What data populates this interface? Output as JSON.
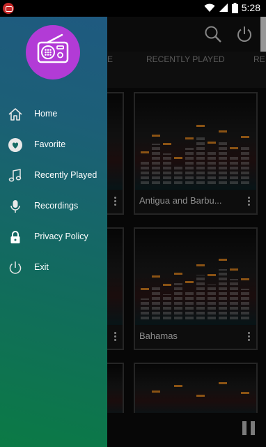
{
  "status_bar": {
    "time": "5:28",
    "icons": [
      "notification-icon",
      "wifi-icon",
      "signal-icon",
      "battery-icon"
    ]
  },
  "app_bar": {
    "icons": [
      "search-icon",
      "power-icon"
    ]
  },
  "tabs": [
    {
      "label": "E"
    },
    {
      "label": "RECENTLY PLAYED"
    },
    {
      "label": "RE"
    }
  ],
  "stations": [
    {
      "title": "Antigua and Barbu..."
    },
    {
      "title": "Bahamas"
    }
  ],
  "drawer": {
    "logo_icon": "radio-icon",
    "items": [
      {
        "label": "Home",
        "icon": "home-icon"
      },
      {
        "label": "Favorite",
        "icon": "heart-icon"
      },
      {
        "label": "Recently Played",
        "icon": "music-note-icon"
      },
      {
        "label": "Recordings",
        "icon": "microphone-icon"
      },
      {
        "label": "Privacy Policy",
        "icon": "lock-icon"
      },
      {
        "label": "Exit",
        "icon": "power-icon"
      }
    ]
  },
  "player": {
    "control_icon": "pause-icon"
  },
  "colors": {
    "drawer_top": "#1f5a80",
    "drawer_bottom": "#0b7a45",
    "logo_circle": "#b23bd6",
    "accent_peak": "#d6801f"
  }
}
